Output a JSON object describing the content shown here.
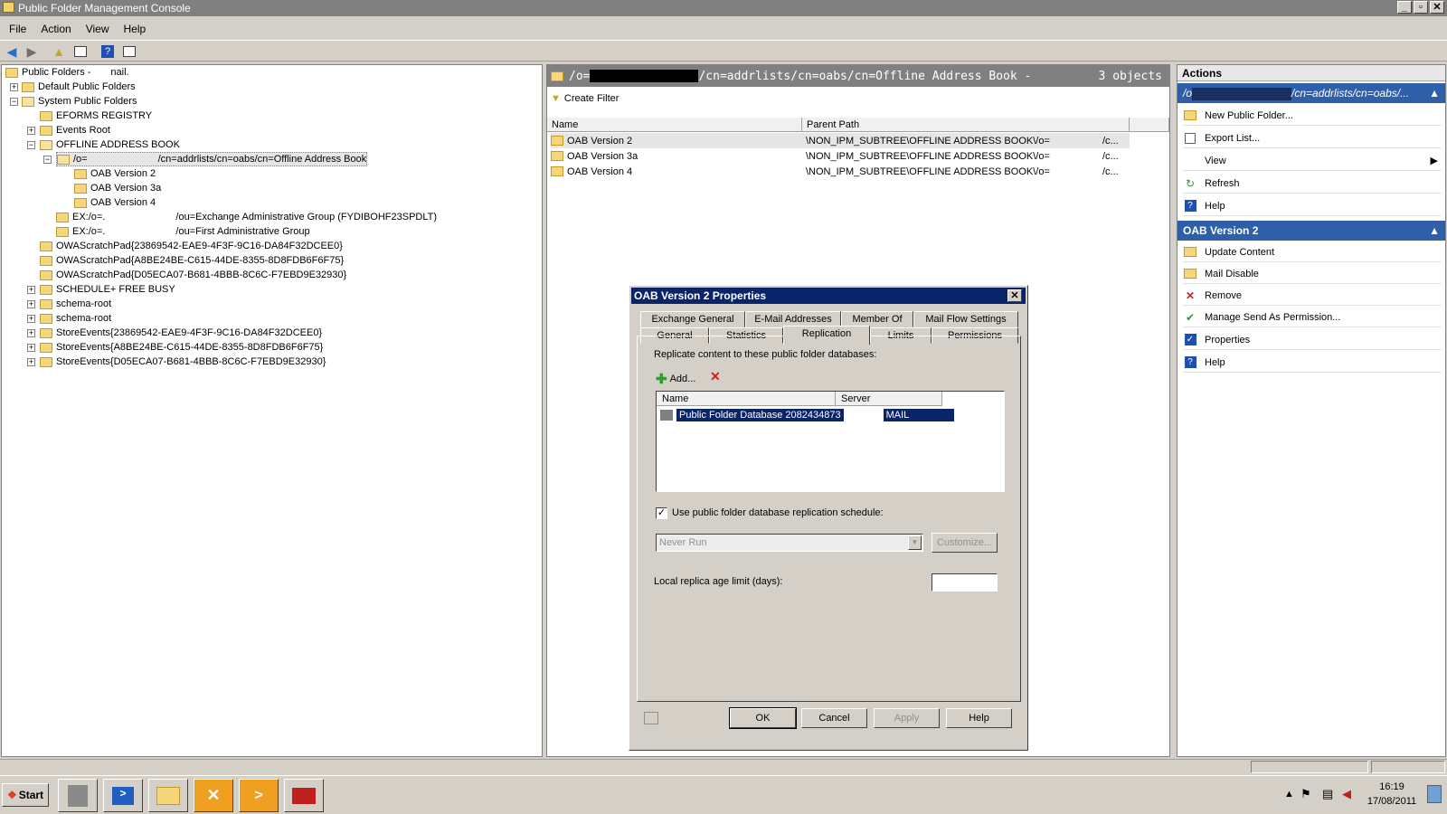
{
  "window": {
    "title": "Public Folder Management Console"
  },
  "menu": [
    "File",
    "Action",
    "View",
    "Help"
  ],
  "tree": {
    "root_label": "Public Folders -",
    "root_suffix": "nail.",
    "items": [
      {
        "label": "Default Public Folders"
      },
      {
        "label": "System Public Folders"
      },
      {
        "label": "EFORMS REGISTRY"
      },
      {
        "label": "Events Root"
      },
      {
        "label": "OFFLINE ADDRESS BOOK"
      },
      {
        "label_a": "/o=",
        "label_b": "/cn=addrlists/cn=oabs/cn=Offline Address Book"
      },
      {
        "label": "OAB Version 2"
      },
      {
        "label": "OAB Version 3a"
      },
      {
        "label": "OAB Version 4"
      },
      {
        "label_a": "EX:/o=.",
        "label_b": "/ou=Exchange Administrative Group (FYDIBOHF23SPDLT)"
      },
      {
        "label_a": "EX:/o=.",
        "label_b": "/ou=First Administrative Group"
      },
      {
        "label": "OWAScratchPad{23869542-EAE9-4F3F-9C16-DA84F32DCEE0}"
      },
      {
        "label": "OWAScratchPad{A8BE24BE-C615-44DE-8355-8D8FDB6F6F75}"
      },
      {
        "label": "OWAScratchPad{D05ECA07-B681-4BBB-8C6C-F7EBD9E32930}"
      },
      {
        "label": "SCHEDULE+ FREE BUSY"
      },
      {
        "label": "schema-root"
      },
      {
        "label": "schema-root"
      },
      {
        "label": "StoreEvents{23869542-EAE9-4F3F-9C16-DA84F32DCEE0}"
      },
      {
        "label": "StoreEvents{A8BE24BE-C615-44DE-8355-8D8FDB6F6F75}"
      },
      {
        "label": "StoreEvents{D05ECA07-B681-4BBB-8C6C-F7EBD9E32930}"
      }
    ]
  },
  "middle": {
    "header_a": "/o=",
    "header_b": "/cn=addrlists/cn=oabs/cn=Offline Address Book -",
    "count": "3 objects",
    "create_filter": "Create Filter",
    "columns": [
      "Name",
      "Parent Path"
    ],
    "rows": [
      {
        "name": "OAB Version 2",
        "path": "\\NON_IPM_SUBTREE\\OFFLINE ADDRESS BOOK\\/o=",
        "tail": "/c..."
      },
      {
        "name": "OAB Version 3a",
        "path": "\\NON_IPM_SUBTREE\\OFFLINE ADDRESS BOOK\\/o=",
        "tail": "/c..."
      },
      {
        "name": "OAB Version 4",
        "path": "\\NON_IPM_SUBTREE\\OFFLINE ADDRESS BOOK\\/o=",
        "tail": "/c..."
      }
    ]
  },
  "actions": {
    "header": "Actions",
    "section1": "/o",
    "section1_tail": "/cn=addrlists/cn=oabs/...",
    "items1": [
      "New Public Folder...",
      "Export List...",
      "View",
      "Refresh",
      "Help"
    ],
    "section2": "OAB Version 2",
    "items2": [
      "Update Content",
      "Mail Disable",
      "Remove",
      "Manage Send As Permission...",
      "Properties",
      "Help"
    ]
  },
  "dialog": {
    "title": "OAB Version 2 Properties",
    "tabs_top": [
      "Exchange General",
      "E-Mail Addresses",
      "Member Of",
      "Mail Flow Settings"
    ],
    "tabs_bottom": [
      "General",
      "Statistics",
      "Replication",
      "Limits",
      "Permissions"
    ],
    "replicate_label": "Replicate content to these public folder databases:",
    "add_label": "Add...",
    "list_cols": [
      "Name",
      "Server"
    ],
    "list_row_a": "Public Folder Database 2082434873",
    "list_row_b": "MAIL",
    "use_schedule": "Use public folder database replication schedule:",
    "schedule_value": "Never Run",
    "customize": "Customize...",
    "replica_age": "Local replica age limit (days):",
    "buttons": [
      "OK",
      "Cancel",
      "Apply",
      "Help"
    ]
  },
  "taskbar": {
    "start": "Start",
    "time": "16:19",
    "date": "17/08/2011"
  }
}
